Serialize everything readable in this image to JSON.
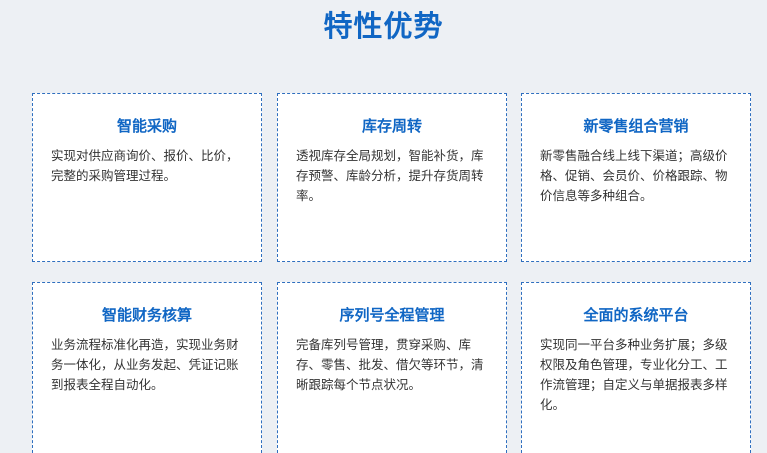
{
  "page": {
    "title": "特性优势"
  },
  "features": [
    {
      "title": "智能采购",
      "description": "实现对供应商询价、报价、比价，完整的采购管理过程。"
    },
    {
      "title": "库存周转",
      "description": "透视库存全局规划，智能补货，库存预警、库龄分析，提升存货周转率。"
    },
    {
      "title": "新零售组合营销",
      "description": "新零售融合线上线下渠道；高级价格、促销、会员价、价格跟踪、物价信息等多种组合。"
    },
    {
      "title": "智能财务核算",
      "description": "业务流程标准化再造，实现业务财务一体化，从业务发起、凭证记账到报表全程自动化。"
    },
    {
      "title": "序列号全程管理",
      "description": "完备库列号管理，贯穿采购、库存、零售、批发、借欠等环节，清晰跟踪每个节点状况。"
    },
    {
      "title": "全面的系统平台",
      "description": "实现同一平台多种业务扩展；多级权限及角色管理，专业化分工、工作流管理；自定义与单据报表多样化。"
    }
  ]
}
